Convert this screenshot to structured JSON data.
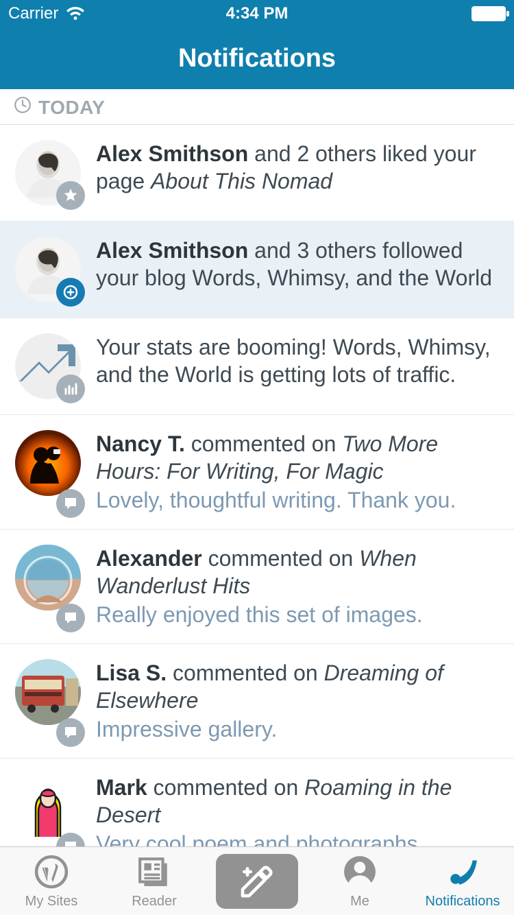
{
  "status": {
    "carrier": "Carrier",
    "time": "4:34 PM"
  },
  "header": {
    "title": "Notifications"
  },
  "section": {
    "label": "TODAY"
  },
  "items": [
    {
      "name": "Alex Smithson",
      "rest": " and 2 others liked your page ",
      "title": "About This Nomad",
      "badge": "star",
      "avatar": "bw"
    },
    {
      "name": "Alex Smithson",
      "rest": " and 3 others followed your blog Words, Whimsy, and the World",
      "badge": "plus",
      "avatar": "bw",
      "selected": true
    },
    {
      "rest": "Your stats are booming! Words, Whimsy, and the World is getting lots of traffic.",
      "badge": "stats",
      "avatar": "trend"
    },
    {
      "name": "Nancy T.",
      "rest": " commented on ",
      "title": "Two More Hours: For Writing, For Magic",
      "comment": "Lovely, thoughtful writing. Thank you.",
      "badge": "comment",
      "avatar": "couple"
    },
    {
      "name": "Alexander",
      "rest": " commented on ",
      "title": "When Wanderlust Hits",
      "comment": "Really enjoyed this set of images.",
      "badge": "comment",
      "avatar": "globe"
    },
    {
      "name": "Lisa S.",
      "rest": " commented on ",
      "title": "Dreaming of Elsewhere",
      "comment": "Impressive gallery.",
      "badge": "comment",
      "avatar": "tram"
    },
    {
      "name": "Mark",
      "rest": " commented on ",
      "title": "Roaming in the Desert",
      "comment": "Very cool poem and photographs.",
      "badge": "comment",
      "avatar": "hoodie"
    }
  ],
  "tabs": {
    "mysites": "My Sites",
    "reader": "Reader",
    "me": "Me",
    "notifications": "Notifications"
  }
}
